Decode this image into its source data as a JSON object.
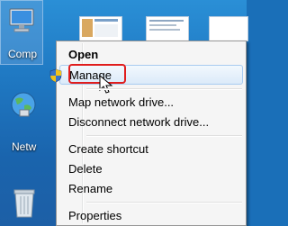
{
  "desktop": {
    "icons": [
      {
        "name": "computer",
        "label": "Comp"
      },
      {
        "name": "network",
        "label": "Netw"
      },
      {
        "name": "recycle-bin",
        "label": ""
      }
    ]
  },
  "context_menu": {
    "items": [
      {
        "label": "Open",
        "bold": true
      },
      {
        "label": "Manage",
        "highlighted": true
      },
      {
        "label": "Map network drive..."
      },
      {
        "label": "Disconnect network drive..."
      },
      {
        "label": "Create shortcut"
      },
      {
        "label": "Delete"
      },
      {
        "label": "Rename"
      },
      {
        "label": "Properties"
      }
    ]
  },
  "colors": {
    "highlight_box": "#e01d1d",
    "menu_bg": "#f5f5f5",
    "desktop_blue": "#1f78c2"
  }
}
